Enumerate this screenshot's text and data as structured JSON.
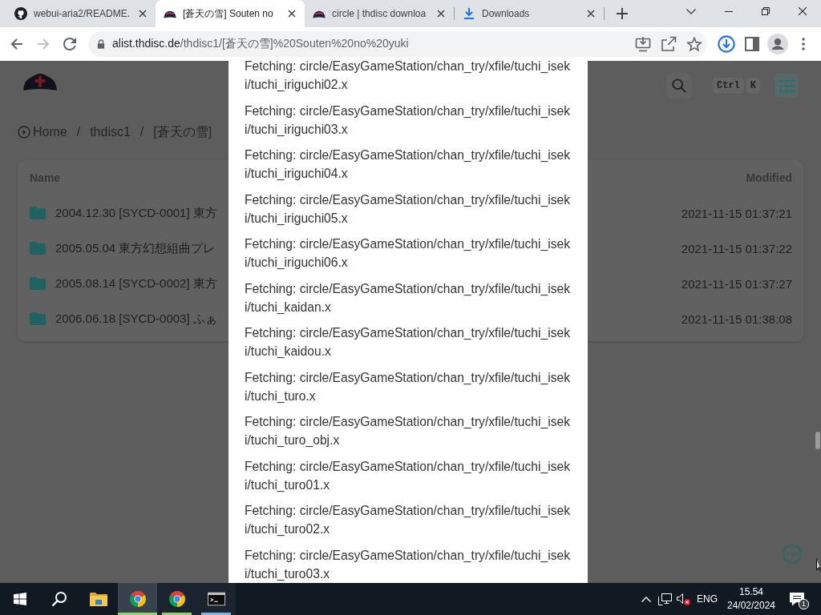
{
  "browser": {
    "tabs": [
      {
        "kind": "cat",
        "title": "webui-aria2/README.",
        "selected": false
      },
      {
        "kind": "hat",
        "title": "[蒼天の雪] Souten no",
        "selected": true
      },
      {
        "kind": "hat",
        "title": "circle | thdisc downloa",
        "selected": false
      },
      {
        "kind": "download",
        "title": "Downloads",
        "selected": false
      }
    ],
    "nav": [
      {
        "kind": "back",
        "disabled": false
      },
      {
        "kind": "forward",
        "disabled": true
      },
      {
        "kind": "reload",
        "disabled": false
      }
    ],
    "address_bar": {
      "host": "alist.thdisc.de",
      "path": "/thdisc1/[蒼天の雪]%20Souten%20no%20yuki"
    }
  },
  "page": {
    "shortcut_keys": [
      "Ctrl",
      "K"
    ],
    "breadcrumbs": [
      {
        "kind": "home",
        "label": "Home",
        "separator": "/"
      },
      {
        "kind": "folder",
        "label": "thdisc1",
        "separator": "/"
      },
      {
        "kind": "folder",
        "label": "[蒼天の雪]"
      }
    ],
    "table": {
      "columns": [
        "Name",
        "Modified"
      ],
      "rows": [
        {
          "name": "2004.12.30 [SYCD-0001] 東方",
          "modified": "2021-11-15 01:37:21"
        },
        {
          "name": "2005.05.04 東方幻想組曲プレ",
          "modified": "2021-11-15 01:37:22"
        },
        {
          "name": "2005.08.14 [SYCD-0002] 東方",
          "modified": "2021-11-15 01:37:27"
        },
        {
          "name": "2006.06.18 [SYCD-0003] ふぁ",
          "modified": "2021-11-15 01:38:08"
        }
      ]
    }
  },
  "dialog": {
    "lines": [
      "Fetching: circle/EasyGameStation/chan_try/xfile/tuchi_iseki/tuchi_iriguchi02.x",
      "Fetching: circle/EasyGameStation/chan_try/xfile/tuchi_iseki/tuchi_iriguchi03.x",
      "Fetching: circle/EasyGameStation/chan_try/xfile/tuchi_iseki/tuchi_iriguchi04.x",
      "Fetching: circle/EasyGameStation/chan_try/xfile/tuchi_iseki/tuchi_iriguchi05.x",
      "Fetching: circle/EasyGameStation/chan_try/xfile/tuchi_iseki/tuchi_iriguchi06.x",
      "Fetching: circle/EasyGameStation/chan_try/xfile/tuchi_iseki/tuchi_kaidan.x",
      "Fetching: circle/EasyGameStation/chan_try/xfile/tuchi_iseki/tuchi_kaidou.x",
      "Fetching: circle/EasyGameStation/chan_try/xfile/tuchi_iseki/tuchi_turo.x",
      "Fetching: circle/EasyGameStation/chan_try/xfile/tuchi_iseki/tuchi_turo_obj.x",
      "Fetching: circle/EasyGameStation/chan_try/xfile/tuchi_iseki/tuchi_turo01.x",
      "Fetching: circle/EasyGameStation/chan_try/xfile/tuchi_iseki/tuchi_turo02.x",
      "Fetching: circle/EasyGameStation/chan_try/xfile/tuchi_iseki/tuchi_turo03.x"
    ]
  },
  "taskbar": {
    "apps": [
      {
        "kind": "start",
        "open": false,
        "selected": false
      },
      {
        "kind": "search",
        "open": false,
        "selected": false
      },
      {
        "kind": "explorer",
        "open": false,
        "selected": false
      },
      {
        "kind": "browser",
        "open": true,
        "selected": true,
        "color": "#8fd46f"
      },
      {
        "kind": "browser",
        "open": true,
        "selected": false,
        "color": "#8fd46f"
      },
      {
        "kind": "terminal",
        "open": true,
        "selected": false,
        "color": "#7fb4e6"
      }
    ],
    "tray": {
      "speaker_muted": true,
      "language": "ENG",
      "time": "15.54",
      "date": "24/02/2024",
      "notification_count": "1"
    }
  }
}
